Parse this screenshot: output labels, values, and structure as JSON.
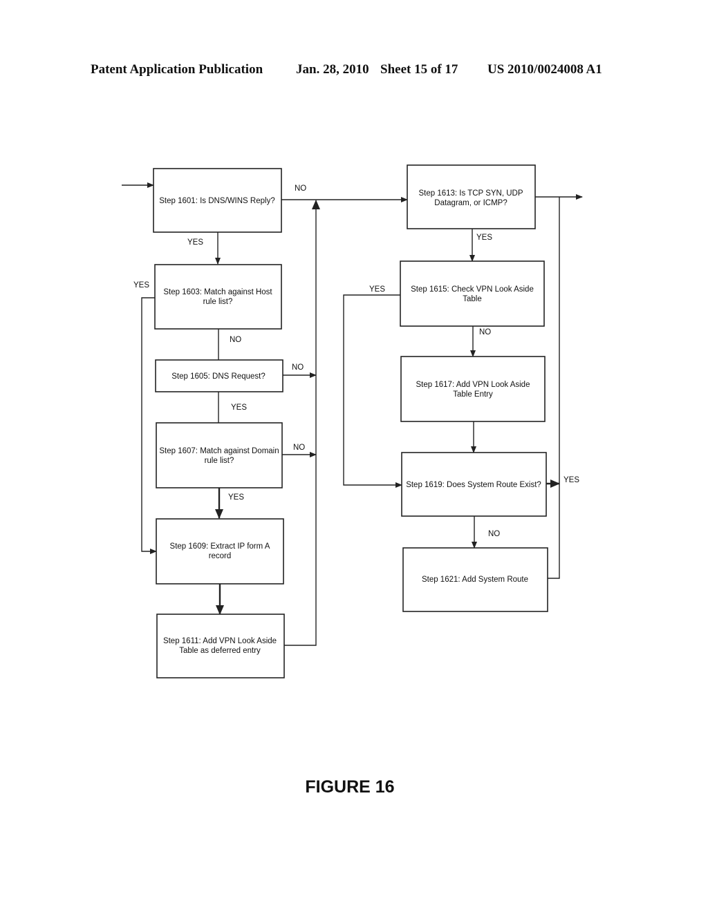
{
  "header": {
    "publication": "Patent Application Publication",
    "date": "Jan. 28, 2010",
    "sheet": "Sheet 15 of 17",
    "number": "US 2010/0024008 A1"
  },
  "steps": {
    "s1601": [
      "Step 1601: Is DNS/WINS Reply?"
    ],
    "s1603": [
      "Step 1603: Match against Host",
      "rule list?"
    ],
    "s1605": [
      "Step 1605: DNS Request?"
    ],
    "s1607": [
      "Step 1607: Match against Domain",
      "rule list?"
    ],
    "s1609": [
      "Step 1609: Extract IP form A",
      "record"
    ],
    "s1611": [
      "Step 1611: Add VPN Look Aside",
      "Table as deferred entry"
    ],
    "s1613": [
      "Step 1613: Is TCP SYN, UDP",
      "Datagram, or ICMP?"
    ],
    "s1615": [
      "Step 1615: Check VPN Look Aside",
      "Table"
    ],
    "s1617": [
      "Step 1617: Add VPN Look Aside",
      "Table Entry"
    ],
    "s1619": [
      "Step 1619: Does System Route Exist?"
    ],
    "s1621": [
      "Step 1621: Add System Route"
    ]
  },
  "labels": {
    "no_1601": "NO",
    "yes_1601": "YES",
    "yes_1603": "YES",
    "no_1603": "NO",
    "no_1605": "NO",
    "yes_1605": "YES",
    "no_1607": "NO",
    "yes_1607": "YES",
    "yes_1613": "YES",
    "yes_1615": "YES",
    "no_1615": "NO",
    "yes_1619": "YES",
    "no_1619": "NO"
  },
  "figure_caption": "FIGURE 16"
}
